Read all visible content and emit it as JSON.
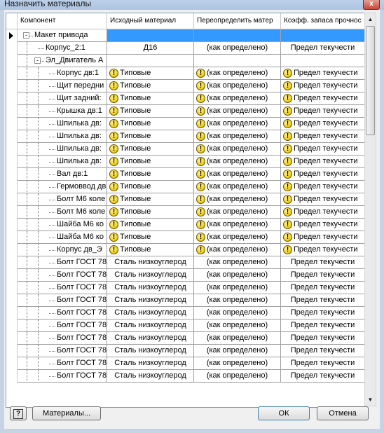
{
  "window": {
    "title": "Назначить материалы",
    "close_glyph": "x"
  },
  "columns": [
    {
      "label": "Компонент"
    },
    {
      "label": "Исходный материал"
    },
    {
      "label": "Переопределить матер"
    },
    {
      "label": "Коэфф. запаса прочнос"
    }
  ],
  "rows": [
    {
      "component": "Макет привода",
      "original": "",
      "override": "",
      "coef": "",
      "level": 0,
      "expander": "-",
      "warn": false,
      "selected": true
    },
    {
      "component": "Корпус_2:1",
      "original": "Д16",
      "override": "(как определено)",
      "coef": "Предел текучести",
      "level": 1,
      "warn": false
    },
    {
      "component": "Эл_Двигатель А",
      "original": "",
      "override": "",
      "coef": "",
      "level": 1,
      "expander": "-",
      "warn": false
    },
    {
      "component": "Корпус дв:1",
      "original": "Типовые",
      "override": "(как определено)",
      "coef": "Предел текучести",
      "level": 2,
      "warn": true
    },
    {
      "component": "Щит передни",
      "original": "Типовые",
      "override": "(как определено)",
      "coef": "Предел текучести",
      "level": 2,
      "warn": true
    },
    {
      "component": "Щит задний:",
      "original": "Типовые",
      "override": "(как определено)",
      "coef": "Предел текучести",
      "level": 2,
      "warn": true
    },
    {
      "component": "Крышка дв:1",
      "original": "Типовые",
      "override": "(как определено)",
      "coef": "Предел текучести",
      "level": 2,
      "warn": true
    },
    {
      "component": "Шпилька дв:",
      "original": "Типовые",
      "override": "(как определено)",
      "coef": "Предел текучести",
      "level": 2,
      "warn": true
    },
    {
      "component": "Шпилька дв:",
      "original": "Типовые",
      "override": "(как определено)",
      "coef": "Предел текучести",
      "level": 2,
      "warn": true
    },
    {
      "component": "Шпилька дв:",
      "original": "Типовые",
      "override": "(как определено)",
      "coef": "Предел текучести",
      "level": 2,
      "warn": true
    },
    {
      "component": "Шпилька дв:",
      "original": "Типовые",
      "override": "(как определено)",
      "coef": "Предел текучести",
      "level": 2,
      "warn": true
    },
    {
      "component": "Вал дв:1",
      "original": "Типовые",
      "override": "(как определено)",
      "coef": "Предел текучести",
      "level": 2,
      "warn": true
    },
    {
      "component": "Гермоввод дв",
      "original": "Типовые",
      "override": "(как определено)",
      "coef": "Предел текучести",
      "level": 2,
      "warn": true
    },
    {
      "component": "Болт М6 коле",
      "original": "Типовые",
      "override": "(как определено)",
      "coef": "Предел текучести",
      "level": 2,
      "warn": true
    },
    {
      "component": "Болт М6 коле",
      "original": "Типовые",
      "override": "(как определено)",
      "coef": "Предел текучести",
      "level": 2,
      "warn": true
    },
    {
      "component": "Шайба М6 ко",
      "original": "Типовые",
      "override": "(как определено)",
      "coef": "Предел текучести",
      "level": 2,
      "warn": true
    },
    {
      "component": "Шайба М6 ко",
      "original": "Типовые",
      "override": "(как определено)",
      "coef": "Предел текучести",
      "level": 2,
      "warn": true
    },
    {
      "component": "Корпус дв_Э",
      "original": "Типовые",
      "override": "(как определено)",
      "coef": "Предел текучести",
      "level": 2,
      "warn": true
    },
    {
      "component": "Болт ГОСТ 78",
      "original": "Сталь низкоуглерод",
      "override": "(как определено)",
      "coef": "Предел текучести",
      "level": 2,
      "warn": false
    },
    {
      "component": "Болт ГОСТ 78",
      "original": "Сталь низкоуглерод",
      "override": "(как определено)",
      "coef": "Предел текучести",
      "level": 2,
      "warn": false
    },
    {
      "component": "Болт ГОСТ 78",
      "original": "Сталь низкоуглерод",
      "override": "(как определено)",
      "coef": "Предел текучести",
      "level": 2,
      "warn": false
    },
    {
      "component": "Болт ГОСТ 78",
      "original": "Сталь низкоуглерод",
      "override": "(как определено)",
      "coef": "Предел текучести",
      "level": 2,
      "warn": false
    },
    {
      "component": "Болт ГОСТ 78",
      "original": "Сталь низкоуглерод",
      "override": "(как определено)",
      "coef": "Предел текучести",
      "level": 2,
      "warn": false
    },
    {
      "component": "Болт ГОСТ 78",
      "original": "Сталь низкоуглерод",
      "override": "(как определено)",
      "coef": "Предел текучести",
      "level": 2,
      "warn": false
    },
    {
      "component": "Болт ГОСТ 78",
      "original": "Сталь низкоуглерод",
      "override": "(как определено)",
      "coef": "Предел текучести",
      "level": 2,
      "warn": false
    },
    {
      "component": "Болт ГОСТ 78",
      "original": "Сталь низкоуглерод",
      "override": "(как определено)",
      "coef": "Предел текучести",
      "level": 2,
      "warn": false
    },
    {
      "component": "Болт ГОСТ 78",
      "original": "Сталь низкоуглерод",
      "override": "(как определено)",
      "coef": "Предел текучести",
      "level": 2,
      "warn": false
    },
    {
      "component": "Болт ГОСТ 78",
      "original": "Сталь низкоуглерод",
      "override": "(как определено)",
      "coef": "Предел текучести",
      "level": 2,
      "warn": false
    }
  ],
  "scrollbar": {
    "up_glyph": "▲",
    "down_glyph": "▼"
  },
  "buttons": {
    "help_label": "?",
    "materials_label": "Материалы...",
    "ok_label": "ОК",
    "cancel_label": "Отмена"
  },
  "icons": {
    "warning": "warning-icon",
    "warning_glyph": "!"
  },
  "colors": {
    "selection": "#3399ff"
  }
}
